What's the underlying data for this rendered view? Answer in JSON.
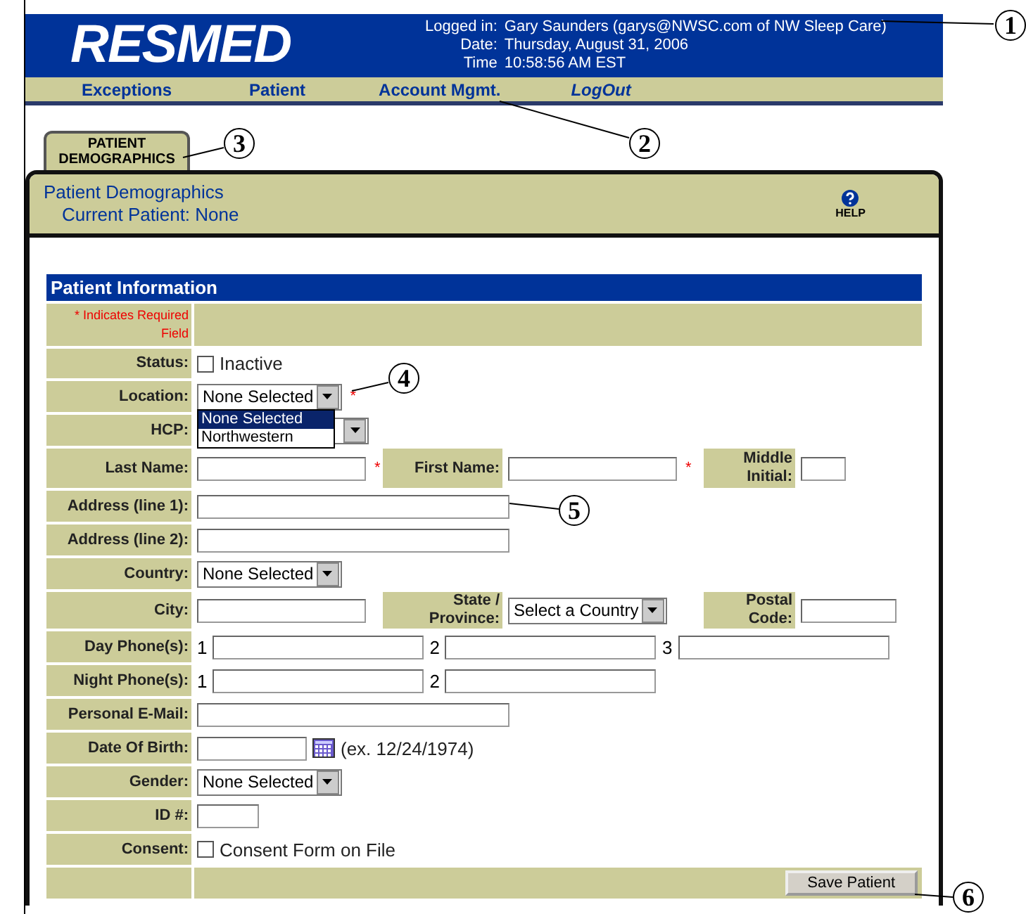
{
  "header": {
    "logo": "RESMED",
    "info": [
      {
        "label": "Logged in:",
        "value": "Gary Saunders (garys@NWSC.com of NW Sleep Care)"
      },
      {
        "label": "Date:",
        "value": "Thursday, August 31, 2006"
      },
      {
        "label": "Time",
        "value": "10:58:56 AM EST"
      }
    ]
  },
  "nav": [
    {
      "label": "Exceptions",
      "italic": false
    },
    {
      "label": "Patient",
      "italic": false
    },
    {
      "label": "Account Mgmt.",
      "italic": false
    },
    {
      "label": "LogOut",
      "italic": true
    }
  ],
  "tab": {
    "label": "PATIENT DEMOGRAPHICS",
    "selected": true
  },
  "panel": {
    "title": "Patient Demographics",
    "subtitle": "Current Patient: None",
    "help": "HELP"
  },
  "section": "Patient Information",
  "rows": [
    {
      "kind": "note",
      "label": "* Indicates Required Field"
    },
    {
      "kind": "field",
      "label": "Status:",
      "segments": [
        {
          "kind": "group",
          "items": [
            {
              "kind": "checkbox",
              "label": "Inactive",
              "checked": false
            }
          ]
        }
      ]
    },
    {
      "kind": "field",
      "label": "Location:",
      "segments": [
        {
          "kind": "group",
          "items": [
            {
              "kind": "select",
              "value": "None Selected",
              "required_mark": "*",
              "open": true,
              "options": [
                {
                  "label": "None Selected",
                  "selected": true
                },
                {
                  "label": "Northwestern",
                  "selected": false
                }
              ]
            }
          ]
        }
      ]
    },
    {
      "kind": "field",
      "label": "HCP:",
      "segments": [
        {
          "kind": "group",
          "items": [
            {
              "kind": "select"
            }
          ]
        }
      ]
    },
    {
      "kind": "field",
      "label": "Last Name:",
      "segments": [
        {
          "kind": "group",
          "items": [
            {
              "kind": "input",
              "required_mark": "*"
            }
          ]
        },
        {
          "kind": "label",
          "text": "First Name:"
        },
        {
          "kind": "group",
          "items": [
            {
              "kind": "input",
              "required_mark": "*"
            }
          ]
        },
        {
          "kind": "label",
          "text": "Middle Initial:"
        },
        {
          "kind": "group",
          "items": [
            {
              "kind": "input"
            }
          ]
        }
      ]
    },
    {
      "kind": "field",
      "label": "Address (line 1):",
      "segments": [
        {
          "kind": "group",
          "items": [
            {
              "kind": "input"
            }
          ]
        }
      ]
    },
    {
      "kind": "field",
      "label": "Address (line 2):",
      "segments": [
        {
          "kind": "group",
          "items": [
            {
              "kind": "input"
            }
          ]
        }
      ]
    },
    {
      "kind": "field",
      "label": "Country:",
      "segments": [
        {
          "kind": "group",
          "items": [
            {
              "kind": "select",
              "value": "None Selected"
            }
          ]
        }
      ]
    },
    {
      "kind": "field",
      "label": "City:",
      "segments": [
        {
          "kind": "group",
          "items": [
            {
              "kind": "input"
            }
          ]
        },
        {
          "kind": "label",
          "text": "State / Province:"
        },
        {
          "kind": "group",
          "items": [
            {
              "kind": "select",
              "value": "Select a Country"
            }
          ]
        },
        {
          "kind": "label",
          "text": "Postal Code:"
        },
        {
          "kind": "group",
          "items": [
            {
              "kind": "input"
            }
          ]
        }
      ]
    },
    {
      "kind": "field",
      "label": "Day Phone(s):",
      "segments": [
        {
          "kind": "group",
          "items": [
            {
              "kind": "prefix",
              "text": "1"
            },
            {
              "kind": "input"
            },
            {
              "kind": "prefix",
              "text": "2"
            },
            {
              "kind": "input"
            },
            {
              "kind": "prefix",
              "text": "3"
            },
            {
              "kind": "input"
            }
          ]
        }
      ]
    },
    {
      "kind": "field",
      "label": "Night Phone(s):",
      "segments": [
        {
          "kind": "group",
          "items": [
            {
              "kind": "prefix",
              "text": "1"
            },
            {
              "kind": "input"
            },
            {
              "kind": "prefix",
              "text": "2"
            },
            {
              "kind": "input"
            }
          ]
        }
      ]
    },
    {
      "kind": "field",
      "label": "Personal E-Mail:",
      "segments": [
        {
          "kind": "group",
          "items": [
            {
              "kind": "input"
            }
          ]
        }
      ]
    },
    {
      "kind": "field",
      "label": "Date Of Birth:",
      "segments": [
        {
          "kind": "group",
          "items": [
            {
              "kind": "input"
            },
            {
              "kind": "calendar"
            },
            {
              "kind": "hint",
              "text": "(ex. 12/24/1974)"
            }
          ]
        }
      ]
    },
    {
      "kind": "field",
      "label": "Gender:",
      "segments": [
        {
          "kind": "group",
          "items": [
            {
              "kind": "select",
              "value": "None Selected"
            }
          ]
        }
      ]
    },
    {
      "kind": "field",
      "label": "ID #:",
      "segments": [
        {
          "kind": "group",
          "items": [
            {
              "kind": "input"
            }
          ]
        }
      ]
    },
    {
      "kind": "field",
      "label": "Consent:",
      "segments": [
        {
          "kind": "group",
          "items": [
            {
              "kind": "checkbox",
              "label": "Consent Form on File",
              "checked": false
            }
          ]
        }
      ]
    },
    {
      "kind": "footer",
      "button": "Save Patient"
    }
  ],
  "callouts": [
    "1",
    "2",
    "3",
    "4",
    "5",
    "6"
  ]
}
